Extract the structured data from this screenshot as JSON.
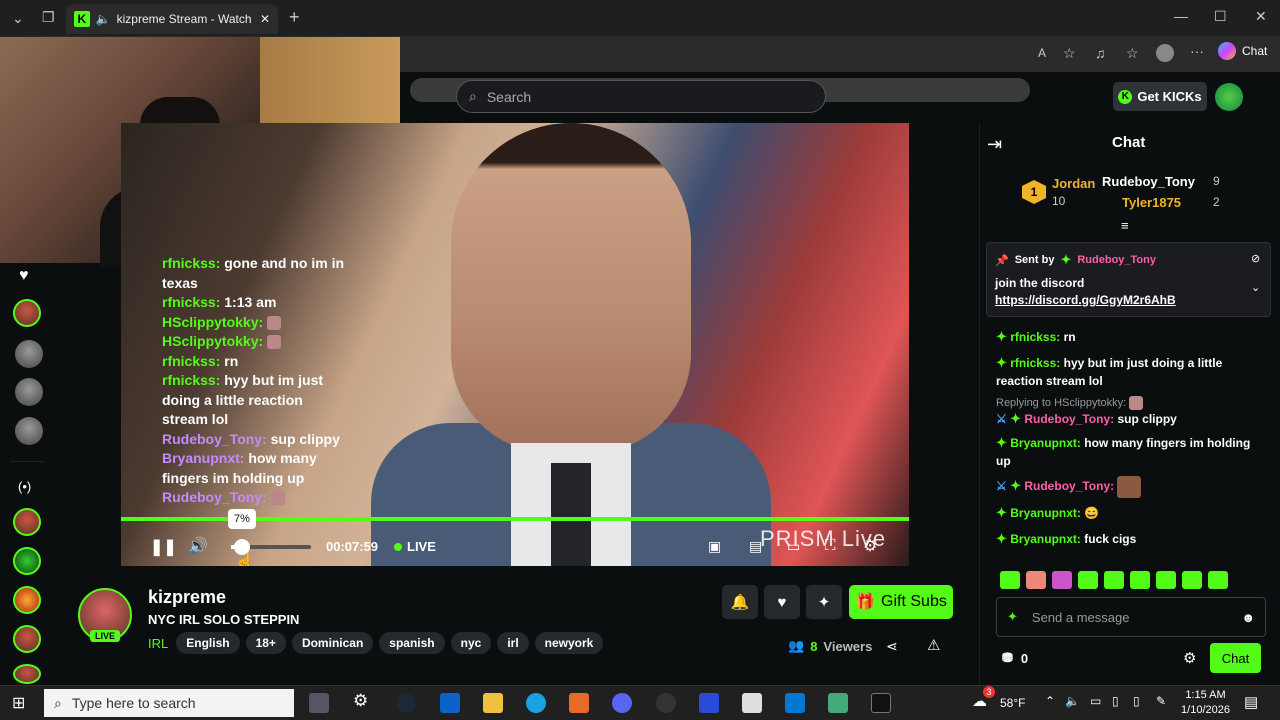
{
  "browser": {
    "tab_title": "kizpreme Stream - Watch Live",
    "chat_button": "Chat",
    "colors": {
      "brand": "#53fc18"
    }
  },
  "nav": {
    "search_placeholder": "Search",
    "get_kicks": "Get KICKs"
  },
  "overlay_chat": [
    {
      "user": "rfnickss:",
      "text": "gone and no im in"
    },
    {
      "user": "",
      "text": "texas"
    },
    {
      "user": "rfnickss:",
      "text": "1:13 am"
    },
    {
      "user": "HSclippytokky:",
      "text": ""
    },
    {
      "user": "HSclippytokky:",
      "text": ""
    },
    {
      "user": "rfnickss:",
      "text": "rn"
    },
    {
      "user": "rfnickss:",
      "text": "hyy but im just"
    },
    {
      "user": "",
      "text": "doing a little reaction"
    },
    {
      "user": "",
      "text": "stream lol"
    },
    {
      "user": "Rudeboy_Tony:",
      "text": "sup clippy"
    },
    {
      "user": "Bryanupnxt:",
      "text": "how many"
    },
    {
      "user": "",
      "text": "fingers im holding up"
    },
    {
      "user": "Rudeboy_Tony:",
      "text": ""
    },
    {
      "user": "Bryanupnxt:",
      "text": ""
    }
  ],
  "player": {
    "volume_tooltip": "7%",
    "time": "00:07:59",
    "live": "LIVE",
    "watermark": "PRISM Live"
  },
  "channel": {
    "name": "kizpreme",
    "live_badge": "LIVE",
    "title": "NYC IRL SOLO STEPPIN",
    "category": "IRL",
    "tags": [
      "English",
      "18+",
      "Dominican",
      "spanish",
      "nyc",
      "irl",
      "newyork"
    ],
    "gift_subs": "Gift Subs",
    "viewers_count": "8",
    "viewers_label": "Viewers"
  },
  "chat": {
    "title": "Chat",
    "leaderboard": {
      "rank": "1",
      "first": {
        "name": "Jordan",
        "count": "10"
      },
      "second": {
        "name": "Rudeboy_Tony",
        "count": "9"
      },
      "third": {
        "name": "Tyler1875",
        "count": "2"
      }
    },
    "pinned": {
      "sent_by": "Sent by",
      "user": "Rudeboy_Tony",
      "text": "join the discord",
      "link": "https://discord.gg/GgyM2r6AhB"
    },
    "messages": [
      {
        "user": "rfnickss:",
        "text": "rn"
      },
      {
        "user": "rfnickss:",
        "text": "hyy but im just doing a little reaction stream lol"
      },
      {
        "reply": "Replying to HSclippytokky:",
        "user": "Rudeboy_Tony:",
        "text": "sup clippy"
      },
      {
        "user": "Bryanupnxt:",
        "text": "how many fingers im holding up"
      },
      {
        "user": "Rudeboy_Tony:",
        "text": ""
      },
      {
        "user": "Bryanupnxt:",
        "text": "😄"
      },
      {
        "user": "Bryanupnxt:",
        "text": "fuck cigs"
      }
    ],
    "input_placeholder": "Send a message",
    "kicks_count": "0",
    "send_button": "Chat"
  },
  "taskbar": {
    "search_placeholder": "Type here to search",
    "weather_badge": "3",
    "temperature": "58°F",
    "time": "1:15 AM",
    "date": "1/10/2026"
  }
}
